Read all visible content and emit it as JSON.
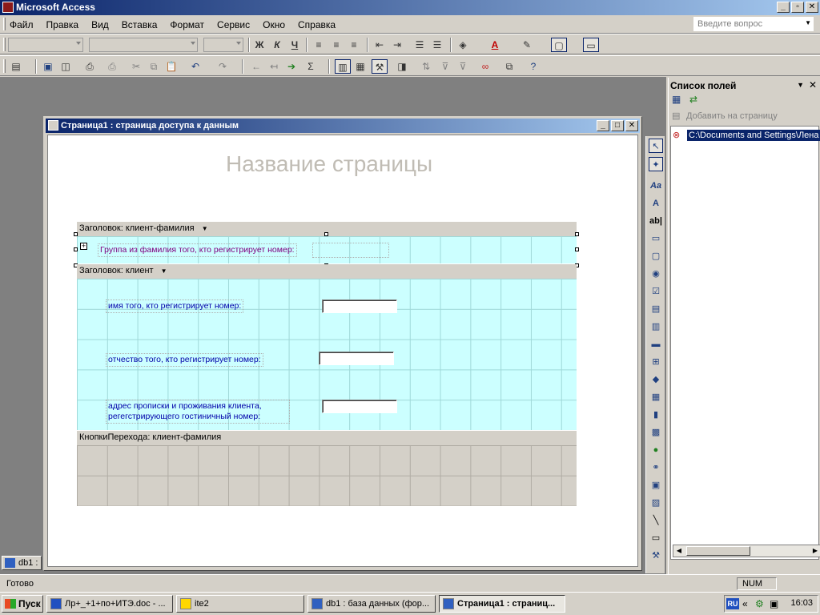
{
  "app": {
    "title": "Microsoft Access",
    "caption_buttons": {
      "minimize": "_",
      "maximize": "▫",
      "close": "✕"
    }
  },
  "menubar": {
    "items": [
      "Файл",
      "Правка",
      "Вид",
      "Вставка",
      "Формат",
      "Сервис",
      "Окно",
      "Справка"
    ],
    "help_placeholder": "Введите вопрос"
  },
  "toolbar1": {
    "bold": "Ж",
    "italic": "К",
    "underline": "Ч",
    "font_color_glyph": "A"
  },
  "toolbar2": {
    "sum_glyph": "Σ"
  },
  "document": {
    "window_title": "Страница1 : страница доступа к данным",
    "page_title": "Название страницы",
    "sections": {
      "header1": "Заголовок: клиент-фамилия",
      "group_label": "Группа из фамилия того, кто регистрирует номер:",
      "header2": "Заголовок: клиент",
      "label_name": "имя того, кто регистрирует номер:",
      "label_patronymic": "отчество того, кто регистрирует номер:",
      "label_address": "адрес прописки и проживания клиента, регегстрирующего гостиничный номер:",
      "navigation": "КнопкиПерехода: клиент-фамилия"
    }
  },
  "minimized_window": {
    "label": "db1 :"
  },
  "field_list": {
    "title": "Список полей",
    "add_to_page": "Добавить на страницу",
    "tree_item": "C:\\Documents and Settings\\Лена"
  },
  "statusbar": {
    "text": "Готово",
    "num": "NUM"
  },
  "taskbar": {
    "start": "Пуск",
    "items": [
      "Лр+_+1+по+ИТЭ.doc - ...",
      "ite2",
      "db1 : база данных (фор...",
      "Страница1 : страниц..."
    ],
    "tray": {
      "lang": "RU",
      "chevron": "«",
      "time": "16:03"
    }
  }
}
